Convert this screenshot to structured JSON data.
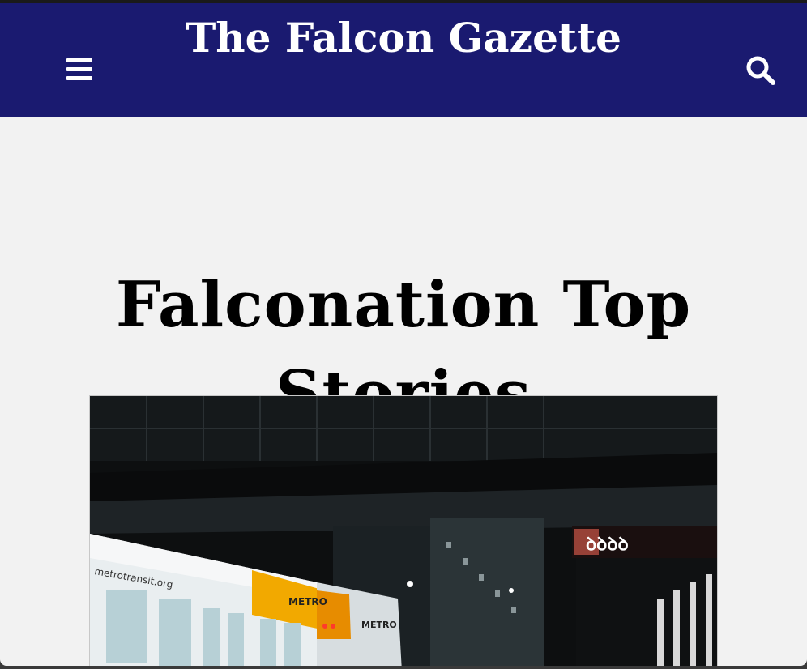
{
  "header": {
    "brand": "The Falcon Gazette",
    "menu_icon": "hamburger-menu-icon",
    "search_icon": "search-icon",
    "background_color": "#1a1a70"
  },
  "main": {
    "section_title": "Falconation Top Stories",
    "featured_story": {
      "image_description_icon": "train-station-photo",
      "train_text_1": "metrotransit.org",
      "train_text_2": "METRO",
      "train_text_3": "METRO",
      "sign_text": "ꝺꝺꝺ"
    }
  }
}
